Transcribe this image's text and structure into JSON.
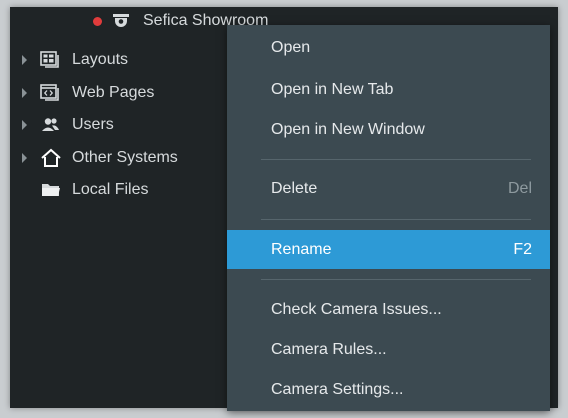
{
  "tree": {
    "camera": {
      "label": "Sefica Showroom",
      "status_color": "#e03c3c",
      "icon": "camera-icon"
    },
    "items": [
      {
        "label": "Layouts",
        "icon": "layouts-icon",
        "expandable": true
      },
      {
        "label": "Web Pages",
        "icon": "web-pages-icon",
        "expandable": true
      },
      {
        "label": "Users",
        "icon": "users-icon",
        "expandable": true
      },
      {
        "label": "Other Systems",
        "icon": "home-icon",
        "expandable": true
      },
      {
        "label": "Local Files",
        "icon": "folder-icon",
        "expandable": false
      }
    ]
  },
  "menu": {
    "open": "Open",
    "open_new_tab": "Open in New Tab",
    "open_new_window": "Open in New Window",
    "delete": "Delete",
    "delete_shortcut": "Del",
    "rename": "Rename",
    "rename_shortcut": "F2",
    "check_issues": "Check Camera Issues...",
    "camera_rules": "Camera Rules...",
    "camera_settings": "Camera Settings...",
    "highlight_color": "#2d9ad6"
  }
}
